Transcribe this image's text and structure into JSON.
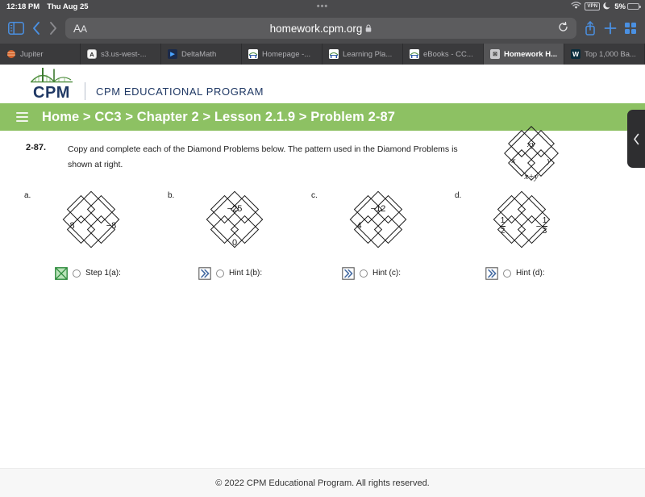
{
  "status_bar": {
    "time": "12:18 PM",
    "date": "Thu Aug 25",
    "dots": "•••",
    "wifi_icon": "wifi-icon",
    "vpn_label": "VPN",
    "moon_icon": "crescent-moon-icon",
    "battery_percent": "5%",
    "battery_level": 5,
    "battery_color": "#e6b33c"
  },
  "browser": {
    "sidebar_icon": "sidebar-toggle-icon",
    "back_icon": "chevron-left-icon",
    "forward_icon": "chevron-right-icon",
    "text_size_label": "AA",
    "url": "homework.cpm.org",
    "lock_icon": "lock-icon",
    "reload_icon": "reload-icon",
    "share_icon": "share-icon",
    "newtab_icon": "plus-icon",
    "tabs_icon": "tab-overview-icon",
    "accent_color": "#3b82f6",
    "tabs": [
      {
        "label": "Jupiter",
        "favicon": "jupiter-favicon",
        "favicon_text": "",
        "active": false
      },
      {
        "label": "s3.us-west-...",
        "favicon": "s3-favicon",
        "favicon_text": "A",
        "active": false
      },
      {
        "label": "DeltaMath",
        "favicon": "deltamath-favicon",
        "favicon_text": "▶",
        "active": false
      },
      {
        "label": "Homepage -...",
        "favicon": "cpm-favicon",
        "favicon_text": "",
        "active": false
      },
      {
        "label": "Learning Pla...",
        "favicon": "cpm-favicon",
        "favicon_text": "",
        "active": false
      },
      {
        "label": "eBooks - CC...",
        "favicon": "cpm-favicon",
        "favicon_text": "",
        "active": false
      },
      {
        "label": "Homework H...",
        "favicon": "homework-favicon",
        "favicon_text": "⊠",
        "active": true
      },
      {
        "label": "Top 1,000 Ba...",
        "favicon": "w-favicon",
        "favicon_text": "W",
        "active": false
      }
    ]
  },
  "site": {
    "logo_text": "CPM",
    "logo_tagline": "CPM EDUCATIONAL PROGRAM",
    "brand_navy": "#1f3864",
    "brand_green": "#8dc163",
    "breadcrumb": "Home > CC3 > Chapter 2 > Lesson 2.1.9 > Problem 2-87",
    "menu_icon": "hamburger-menu-icon",
    "footer": "© 2022 CPM Educational Program. All rights reserved.",
    "side_panel_icon": "chevron-left-icon"
  },
  "problem": {
    "number": "2-87.",
    "text": "Copy and complete each of the Diamond Problems below. The pattern used in the Diamond Problems is shown at right.",
    "reference_diamond": {
      "name": "reference-pattern-diamond",
      "top": "xy",
      "left": "x",
      "right": "y",
      "bottom": "x+y"
    },
    "parts": [
      {
        "letter": "a.",
        "diamond": {
          "top": "",
          "left": "8",
          "right": "−8",
          "bottom": ""
        },
        "hint_icon": "green-x-box-icon",
        "hint_icon_color": "#2e8b3d",
        "hint_label": "Step 1(a):"
      },
      {
        "letter": "b.",
        "diamond": {
          "top": "−25",
          "left": "",
          "right": "",
          "bottom": "0"
        },
        "hint_icon": "double-chevron-icon",
        "hint_icon_color": "#4a6fa5",
        "hint_label": "Hint 1(b):"
      },
      {
        "letter": "c.",
        "diamond": {
          "top": "−12",
          "left": "4",
          "right": "",
          "bottom": ""
        },
        "hint_icon": "double-chevron-icon",
        "hint_icon_color": "#4a6fa5",
        "hint_label": "Hint (c):"
      },
      {
        "letter": "d.",
        "diamond": {
          "top": "",
          "left": "1/2",
          "right": "−1/3",
          "bottom": "",
          "left_num": "1",
          "left_den": "2",
          "right_sign": "−",
          "right_num": "1",
          "right_den": "3"
        },
        "hint_icon": "double-chevron-icon",
        "hint_icon_color": "#4a6fa5",
        "hint_label": "Hint (d):"
      }
    ]
  }
}
